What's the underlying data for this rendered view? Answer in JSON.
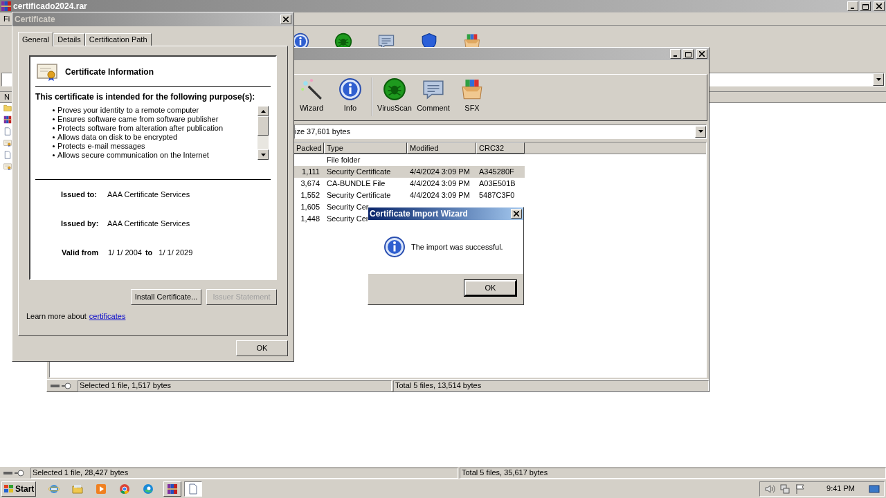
{
  "main_window": {
    "title": "certificado2024.rar",
    "menu": [
      "Fi"
    ],
    "toolbar": [
      {
        "kind": "info"
      },
      {
        "kind": "virusscan"
      },
      {
        "kind": "comment"
      },
      {
        "kind": "protect"
      },
      {
        "kind": "sfx"
      }
    ],
    "columns": [
      "N"
    ],
    "rows": [
      {
        "kind": "folder"
      },
      {
        "kind": "archive"
      },
      {
        "kind": "file"
      },
      {
        "kind": "certificate"
      },
      {
        "kind": "file"
      },
      {
        "kind": "certificate"
      }
    ],
    "status_bar": {
      "selection": "Selected 1 file, 28,427 bytes",
      "total": "Total 5 files, 35,617 bytes"
    }
  },
  "archive_window": {
    "toolbar": [
      {
        "kind": "wizard",
        "label": "Wizard",
        "separator_before": false
      },
      {
        "kind": "info",
        "label": "Info",
        "separator_before": false
      },
      {
        "kind": "virusscan",
        "label": "VirusScan",
        "separator_before": true
      },
      {
        "kind": "comment",
        "label": "Comment",
        "separator_before": false
      },
      {
        "kind": "sfx",
        "label": "SFX",
        "separator_before": false
      }
    ],
    "path": "ize 37,601 bytes",
    "columns": [
      "Packed",
      "Type",
      "Modified",
      "CRC32"
    ],
    "rows": [
      {
        "type": "File folder",
        "selected": false
      },
      {
        "packed": "1,111",
        "type": "Security Certificate",
        "modified": "4/4/2024 3:09 PM",
        "crc": "A345280F",
        "selected": true
      },
      {
        "packed": "3,674",
        "type": "CA-BUNDLE File",
        "modified": "4/4/2024 3:09 PM",
        "crc": "A03E501B",
        "selected": false
      },
      {
        "packed": "1,552",
        "type": "Security Certificate",
        "modified": "4/4/2024 3:09 PM",
        "crc": "5487C3F0",
        "selected": false
      },
      {
        "packed": "1,605",
        "type": "Security Cer",
        "selected": false
      },
      {
        "packed": "1,448",
        "type": "Security Cer",
        "selected": false
      }
    ],
    "status_bar": {
      "selection": "Selected 1 file, 1,517 bytes",
      "total": "Total 5 files, 13,514 bytes"
    }
  },
  "certificate_dialog": {
    "title": "Certificate",
    "tabs": [
      {
        "label": "General",
        "selected": true
      },
      {
        "label": "Details",
        "selected": false
      },
      {
        "label": "Certification Path",
        "selected": false
      }
    ],
    "heading": "Certificate Information",
    "purpose_title": "This certificate is intended for the following purpose(s):",
    "purposes": [
      "Proves your identity to a remote computer",
      "Ensures software came from software publisher",
      "Protects software from alteration after publication",
      "Allows data on disk to be encrypted",
      "Protects e-mail messages",
      "Allows secure communication on the Internet"
    ],
    "issued_to": {
      "label": "Issued to:",
      "value": "AAA Certificate Services"
    },
    "issued_by": {
      "label": "Issued by:",
      "value": "AAA Certificate Services"
    },
    "valid": {
      "label": "Valid from",
      "from": "1/ 1/ 2004",
      "to_label": "to",
      "to": "1/ 1/ 2029"
    },
    "buttons": [
      {
        "label": "Install Certificate...",
        "disabled": false
      },
      {
        "label": "Issuer Statement",
        "disabled": true
      }
    ],
    "learn_more": {
      "text": "Learn more about",
      "link": "certificates"
    },
    "ok": "OK"
  },
  "import_dialog": {
    "title": "Certificate Import Wizard",
    "message": "The import was successful.",
    "ok": "OK"
  },
  "taskbar": {
    "start": "Start",
    "apps": [
      {
        "kind": "ie"
      },
      {
        "kind": "explorer"
      },
      {
        "kind": "media"
      },
      {
        "kind": "chrome"
      },
      {
        "kind": "edge"
      }
    ],
    "windows": [
      {
        "kind": "winrar",
        "active": false
      },
      {
        "kind": "document",
        "active": true
      }
    ],
    "tray": [
      {
        "kind": "speaker"
      },
      {
        "kind": "network"
      },
      {
        "kind": "flag"
      }
    ],
    "clock": "9:41 PM"
  }
}
